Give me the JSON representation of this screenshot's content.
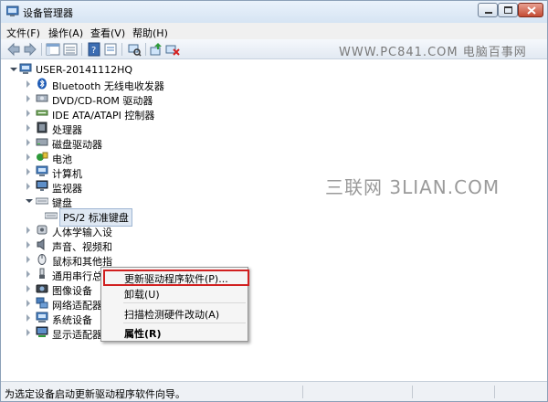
{
  "window": {
    "title": "设备管理器"
  },
  "menu": [
    "文件(F)",
    "操作(A)",
    "查看(V)",
    "帮助(H)"
  ],
  "toolbar": {
    "watermark": "WWW.PC841.COM 电脑百事网"
  },
  "tree": {
    "root": "USER-20141112HQ",
    "items": [
      {
        "label": "Bluetooth 无线电收发器",
        "icon": "bluetooth-icon",
        "state": "collapsed"
      },
      {
        "label": "DVD/CD-ROM 驱动器",
        "icon": "disc-drive-icon",
        "state": "collapsed"
      },
      {
        "label": "IDE ATA/ATAPI 控制器",
        "icon": "ide-controller-icon",
        "state": "collapsed"
      },
      {
        "label": "处理器",
        "icon": "processor-icon",
        "state": "collapsed"
      },
      {
        "label": "磁盘驱动器",
        "icon": "disk-drive-icon",
        "state": "collapsed"
      },
      {
        "label": "电池",
        "icon": "battery-icon",
        "state": "collapsed"
      },
      {
        "label": "计算机",
        "icon": "computer-icon",
        "state": "collapsed"
      },
      {
        "label": "监视器",
        "icon": "monitor-icon",
        "state": "collapsed"
      },
      {
        "label": "键盘",
        "icon": "keyboard-icon",
        "state": "expanded"
      },
      {
        "label": "PS/2 标准键盘",
        "icon": "keyboard-device-icon",
        "state": "child"
      },
      {
        "label": "人体学输入设",
        "icon": "hid-icon",
        "state": "collapsed"
      },
      {
        "label": "声音、视频和",
        "icon": "sound-icon",
        "state": "collapsed"
      },
      {
        "label": "鼠标和其他指",
        "icon": "mouse-icon",
        "state": "collapsed"
      },
      {
        "label": "通用串行总线",
        "icon": "usb-icon",
        "state": "collapsed"
      },
      {
        "label": "图像设备",
        "icon": "imaging-icon",
        "state": "collapsed"
      },
      {
        "label": "网络适配器",
        "icon": "network-adapter-icon",
        "state": "collapsed"
      },
      {
        "label": "系统设备",
        "icon": "system-device-icon",
        "state": "collapsed"
      },
      {
        "label": "显示适配器",
        "icon": "display-adapter-icon",
        "state": "collapsed"
      }
    ]
  },
  "watermark2": "三联网 3LIAN.COM",
  "context_menu": {
    "items": [
      {
        "label": "更新驱动程序软件(P)...",
        "highlighted": true
      },
      {
        "label": "卸载(U)"
      },
      {
        "label": "扫描检测硬件改动(A)"
      },
      {
        "label": "属性(R)",
        "bold": true
      }
    ],
    "highlight_color": "#d12020"
  },
  "statusbar": {
    "text": "为选定设备启动更新驱动程序软件向导。"
  }
}
